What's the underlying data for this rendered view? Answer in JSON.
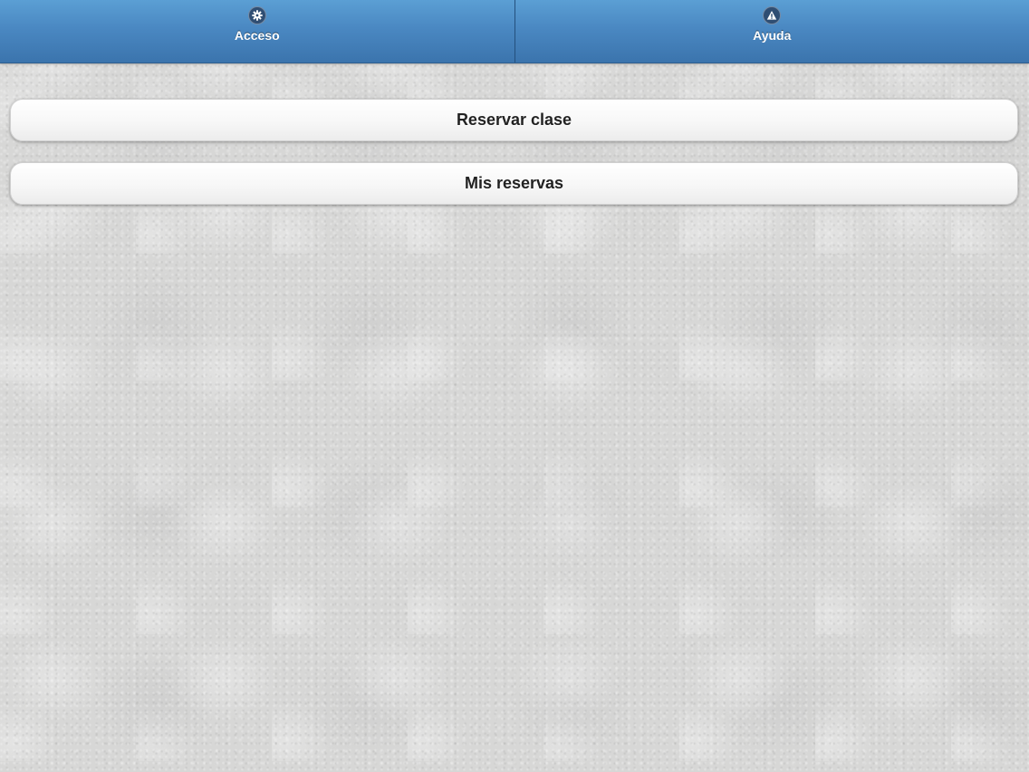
{
  "navbar": {
    "tabs": [
      {
        "label": "Acceso",
        "icon": "gear-icon"
      },
      {
        "label": "Ayuda",
        "icon": "alert-icon"
      }
    ]
  },
  "menu": {
    "items": [
      {
        "label": "Reservar clase"
      },
      {
        "label": "Mis reservas"
      }
    ]
  },
  "colors": {
    "navbar": "#4a88c2",
    "background": "#d7d7d6",
    "button_text": "#222222"
  }
}
